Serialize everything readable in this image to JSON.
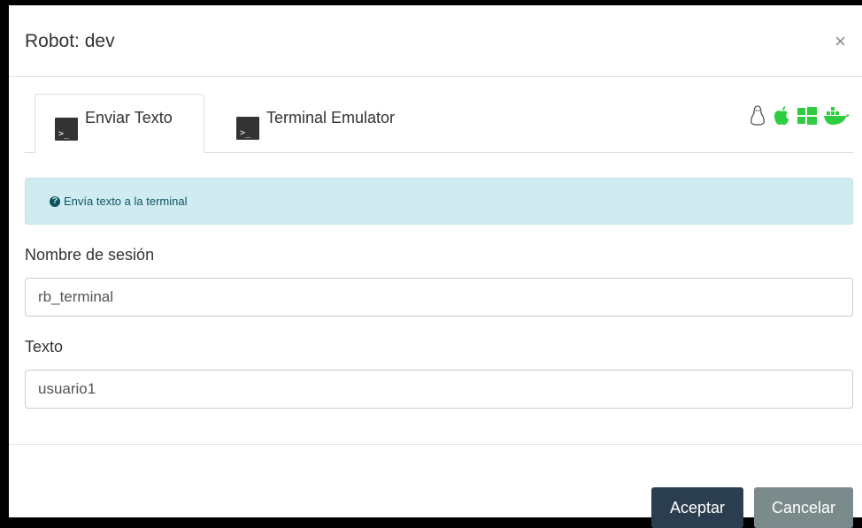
{
  "modal": {
    "title": "Robot: dev",
    "close_label": "×"
  },
  "tabs": [
    {
      "label": "Enviar Texto",
      "active": true
    },
    {
      "label": "Terminal Emulator",
      "active": false
    }
  ],
  "os_icons": [
    "linux-icon",
    "apple-icon",
    "windows-icon",
    "docker-icon"
  ],
  "colors": {
    "os_icon_green": "#2ecc40",
    "alert_bg": "#d1ecf1",
    "primary_button": "#2b3e50",
    "secondary_button": "#7b8a8b"
  },
  "alert": {
    "text": "Envía texto a la terminal"
  },
  "form": {
    "session_label": "Nombre de sesión",
    "session_value": "rb_terminal",
    "text_label": "Texto",
    "text_value": "usuario1"
  },
  "footer": {
    "accept_label": "Aceptar",
    "cancel_label": "Cancelar"
  }
}
